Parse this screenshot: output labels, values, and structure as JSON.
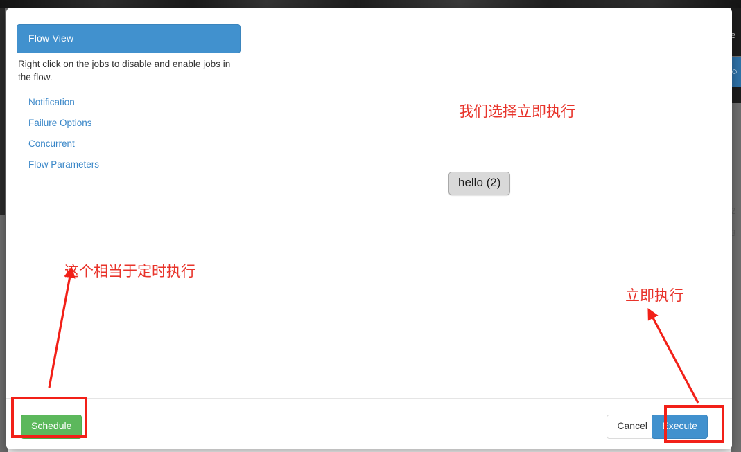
{
  "background": {
    "right_fragment_letter": "e",
    "right_fragment_num2": "2",
    "right_fragment_num3": "3",
    "right_button_glyph": "○"
  },
  "modal": {
    "panel": {
      "header_label": "Flow View",
      "hint_text": "Right click on the jobs to disable and enable jobs in the flow.",
      "links": [
        {
          "label": "Notification"
        },
        {
          "label": "Failure Options"
        },
        {
          "label": "Concurrent"
        },
        {
          "label": "Flow Parameters"
        }
      ]
    },
    "flow": {
      "nodes": [
        {
          "label": "hello (2)"
        }
      ]
    },
    "footer": {
      "schedule_label": "Schedule",
      "cancel_label": "Cancel",
      "execute_label": "Execute"
    }
  },
  "annotations": {
    "color": "#e8332a",
    "box_color": "#f22018",
    "notes": [
      {
        "text": "我们选择立即执行"
      },
      {
        "text": "这个相当于定时执行"
      },
      {
        "text": "立即执行"
      }
    ]
  }
}
